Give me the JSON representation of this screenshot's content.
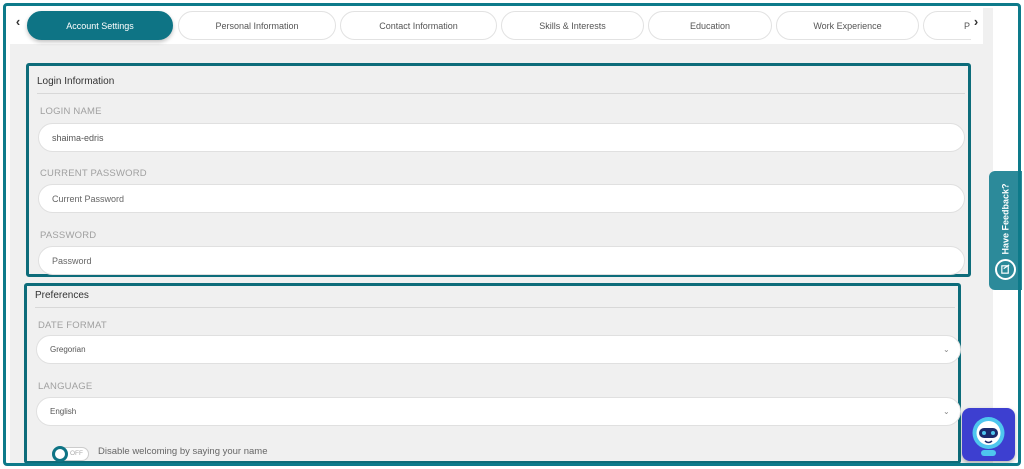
{
  "tabs": [
    {
      "label": "Account Settings",
      "active": true
    },
    {
      "label": "Personal Information",
      "active": false
    },
    {
      "label": "Contact Information",
      "active": false
    },
    {
      "label": "Skills & Interests",
      "active": false
    },
    {
      "label": "Education",
      "active": false
    },
    {
      "label": "Work Experience",
      "active": false
    },
    {
      "label": "P",
      "active": false
    }
  ],
  "login": {
    "title": "Login Information",
    "login_name_label": "LOGIN NAME",
    "login_name_value": "shaima-edris",
    "current_password_label": "CURRENT PASSWORD",
    "current_password_placeholder": "Current Password",
    "password_label": "PASSWORD",
    "password_placeholder": "Password"
  },
  "preferences": {
    "title": "Preferences",
    "date_format_label": "DATE FORMAT",
    "date_format_value": "Gregorian",
    "language_label": "LANGUAGE",
    "language_value": "English",
    "welcome_toggle_state": "OFF",
    "welcome_toggle_label": "Disable welcoming by saying your name"
  },
  "feedback": {
    "label": "Have Feedback?"
  },
  "icons": {
    "tabs_prev": "chevron-left-icon",
    "tabs_next": "chevron-right-icon",
    "select_chevron": "chevron-down-icon",
    "feedback": "feedback-icon",
    "chatbot": "chatbot-icon"
  },
  "colors": {
    "accent": "#0e7485",
    "section_border": "#0d6c7a",
    "feedback_bg": "#2c8a9a",
    "chatbot_bg": "#3d3fd0"
  }
}
